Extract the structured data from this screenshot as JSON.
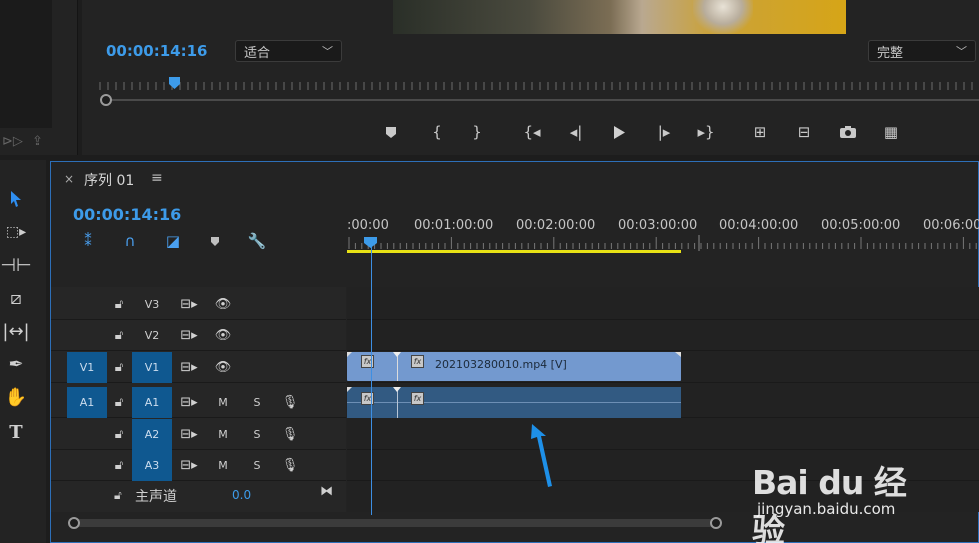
{
  "program_monitor": {
    "timecode": "00:00:14:16",
    "zoom_dropdown": "适合",
    "quality_dropdown": "完整"
  },
  "timeline": {
    "tab_close": "×",
    "tab_title": "序列 01",
    "tab_menu": "≡",
    "timecode": "00:00:14:16",
    "ruler_labels": [
      ":00:00",
      "00:01:00:00",
      "00:02:00:00",
      "00:03:00:00",
      "00:04:00:00",
      "00:05:00:00",
      "00:06:00"
    ],
    "tracks": [
      {
        "name": "V3",
        "type": "video"
      },
      {
        "name": "V2",
        "type": "video"
      },
      {
        "name": "V1",
        "type": "video",
        "source": "V1"
      },
      {
        "name": "A1",
        "type": "audio",
        "source": "A1",
        "mute": "M",
        "solo": "S"
      },
      {
        "name": "A2",
        "type": "audio",
        "mute": "M",
        "solo": "S"
      },
      {
        "name": "A3",
        "type": "audio",
        "mute": "M",
        "solo": "S"
      }
    ],
    "master": {
      "label": "主声道",
      "value": "0.0"
    },
    "clip_video_label": "202103280010.mp4 [V]",
    "fx_label": "fx"
  },
  "watermark": {
    "logo": "Bai du 经验",
    "url": "jingyan.baidu.com"
  },
  "colors": {
    "accent": "#3d9be9",
    "video_clip": "#7399cf",
    "audio_clip": "#325a82",
    "work_area": "#e8e215",
    "target": "#0f5890"
  }
}
